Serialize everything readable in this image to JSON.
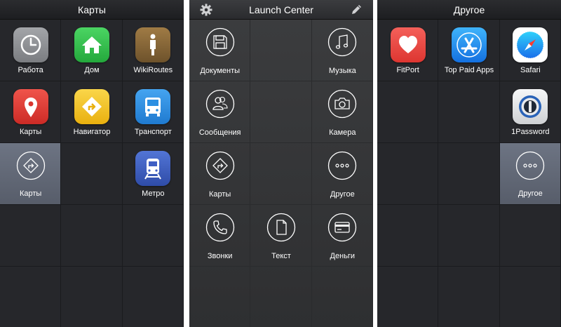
{
  "screens": {
    "left": {
      "title": "Карты",
      "items": [
        {
          "label": "Работа",
          "icon": "clock-icon",
          "color": "#8e9094"
        },
        {
          "label": "Дом",
          "icon": "home-icon",
          "color": "#35c24e"
        },
        {
          "label": "WikiRoutes",
          "icon": "person-icon",
          "color": "#8b6a3a"
        },
        {
          "label": "Карты",
          "icon": "map-pin-icon",
          "color": "#e43b34"
        },
        {
          "label": "Навигатор",
          "icon": "directions-icon",
          "color": "#f4c324"
        },
        {
          "label": "Транспорт",
          "icon": "bus-icon",
          "color": "#2b8fe2"
        },
        {
          "label": "Карты",
          "icon": "directions-circle-icon",
          "selected": true
        },
        {
          "label": "Метро",
          "icon": "train-icon",
          "color": "#3f5fc4"
        }
      ]
    },
    "center": {
      "title": "Launch Center",
      "left_icon": "gear-icon",
      "right_icon": "pencil-icon",
      "items": [
        {
          "label": "Документы",
          "icon": "floppy-disk-icon"
        },
        {
          "label": "Музыка",
          "icon": "music-note-icon"
        },
        {
          "label": "Сообщения",
          "icon": "contacts-icon"
        },
        {
          "label": "Камера",
          "icon": "camera-icon"
        },
        {
          "label": "Карты",
          "icon": "directions-icon"
        },
        {
          "label": "Другое",
          "icon": "more-icon"
        },
        {
          "label": "Звонки",
          "icon": "phone-icon"
        },
        {
          "label": "Текст",
          "icon": "document-icon"
        },
        {
          "label": "Деньги",
          "icon": "credit-card-icon"
        }
      ]
    },
    "right": {
      "title": "Другое",
      "items": [
        {
          "label": "FitPort",
          "icon": "heart-icon",
          "color": "#ec4a45"
        },
        {
          "label": "Top Paid Apps",
          "icon": "app-store-icon",
          "color": "#1e8ef0"
        },
        {
          "label": "Safari",
          "icon": "compass-icon",
          "color": "#ffffff"
        },
        {
          "label": "1Password",
          "icon": "keyhole-icon",
          "color": "#e9eaec"
        },
        {
          "label": "Другое",
          "icon": "more-icon",
          "selected": true
        }
      ]
    }
  }
}
